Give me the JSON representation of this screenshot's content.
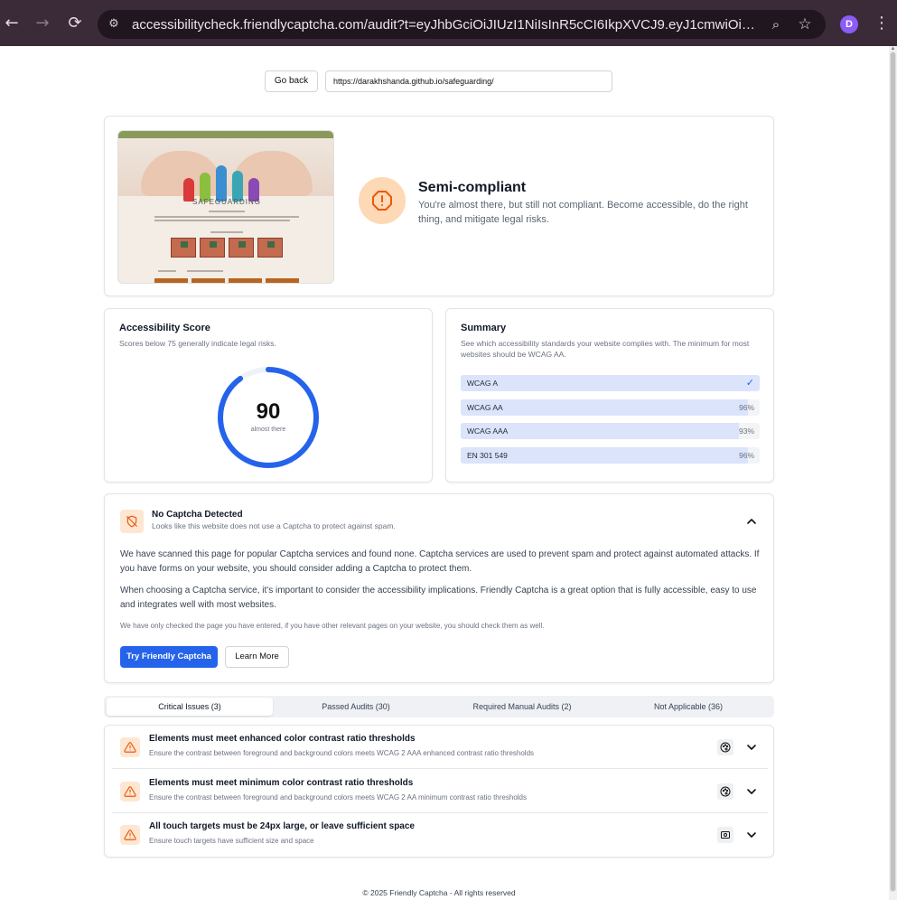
{
  "browser": {
    "url": "accessibilitycheck.friendlycaptcha.com/audit?t=eyJhbGciOiJIUzI1NiIsInR5cCI6IkpXVCJ9.eyJ1cmwiOiJodHRwczo...",
    "back_icon": "←",
    "forward_icon": "→",
    "reload_icon": "⟳",
    "site_icon": "⚙",
    "zoom_icon": "⌕",
    "star_icon": "☆",
    "profile_initial": "D",
    "menu_icon": "⋮"
  },
  "toolbar": {
    "go_back_label": "Go back",
    "url_value": "https://darakhshanda.github.io/safeguarding/"
  },
  "preview": {
    "site_title": "SAFEGUARDING"
  },
  "status": {
    "title": "Semi-compliant",
    "description": "You're almost there, but still not compliant. Become accessible, do the right thing, and mitigate legal risks.",
    "color": "#ea580c"
  },
  "score": {
    "title": "Accessibility Score",
    "subtitle": "Scores below 75 generally indicate legal risks.",
    "value": 90,
    "value_text": "90",
    "caption": "almost there",
    "accent": "#2563eb"
  },
  "summary": {
    "title": "Summary",
    "subtitle": "See which accessibility standards your website complies with. The minimum for most websites should be WCAG AA.",
    "standards": [
      {
        "name": "WCAG A",
        "percent": 100,
        "label": "",
        "passed": true
      },
      {
        "name": "WCAG AA",
        "percent": 96,
        "label": "96%",
        "passed": false
      },
      {
        "name": "WCAG AAA",
        "percent": 93,
        "label": "93%",
        "passed": false
      },
      {
        "name": "EN 301 549",
        "percent": 96,
        "label": "96%",
        "passed": false
      }
    ],
    "check_icon": "✓"
  },
  "captcha": {
    "title": "No Captcha Detected",
    "subtitle": "Looks like this website does not use a Captcha to protect against spam.",
    "paragraph1": "We have scanned this page for popular Captcha services and found none. Captcha services are used to prevent spam and protect against automated attacks. If you have forms on your website, you should consider adding a Captcha to protect them.",
    "paragraph2": "When choosing a Captcha service, it's important to consider the accessibility implications. Friendly Captcha is a great option that is fully accessible, easy to use and integrates well with most websites.",
    "note": "We have only checked the page you have entered, if you have other relevant pages on your website, you should check them as well.",
    "try_label": "Try Friendly Captcha",
    "learn_label": "Learn More"
  },
  "tabs": [
    {
      "label": "Critical Issues (3)",
      "active": true
    },
    {
      "label": "Passed Audits (30)",
      "active": false
    },
    {
      "label": "Required Manual Audits (2)",
      "active": false
    },
    {
      "label": "Not Applicable (36)",
      "active": false
    }
  ],
  "issues": [
    {
      "title": "Elements must meet enhanced color contrast ratio thresholds",
      "description": "Ensure the contrast between foreground and background colors meets WCAG 2 AAA enhanced contrast ratio thresholds",
      "category_icon": "palette-icon"
    },
    {
      "title": "Elements must meet minimum color contrast ratio thresholds",
      "description": "Ensure the contrast between foreground and background colors meets WCAG 2 AA minimum contrast ratio thresholds",
      "category_icon": "palette-icon"
    },
    {
      "title": "All touch targets must be 24px large, or leave sufficient space",
      "description": "Ensure touch targets have sufficient size and space",
      "category_icon": "touch-target-icon"
    }
  ],
  "footer": {
    "text": "© 2025 Friendly Captcha - All rights reserved"
  }
}
